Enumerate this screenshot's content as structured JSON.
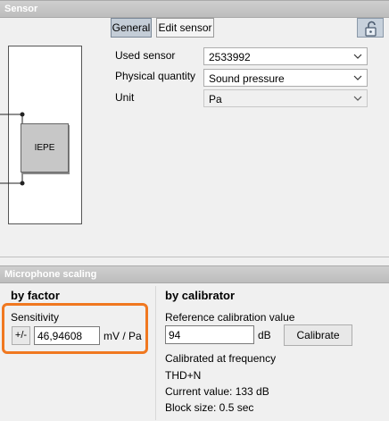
{
  "sensor_section": {
    "title": "Sensor",
    "tabs": [
      {
        "label": "General",
        "active": true
      },
      {
        "label": "Edit sensor",
        "active": false
      }
    ],
    "lock_icon": "unlocked-padlock-icon",
    "diagram": {
      "block_label": "IEPE"
    },
    "fields": {
      "used_sensor": {
        "label": "Used sensor",
        "value": "2533992"
      },
      "physical_quantity": {
        "label": "Physical quantity",
        "value": "Sound pressure"
      },
      "unit": {
        "label": "Unit",
        "value": "Pa"
      }
    }
  },
  "mic_section": {
    "title": "Microphone scaling",
    "by_factor": {
      "title": "by factor",
      "sensitivity_label": "Sensitivity",
      "sign_toggle_label": "+/-",
      "sensitivity_value": "46,94608",
      "sensitivity_unit": "mV / Pa"
    },
    "by_calibrator": {
      "title": "by calibrator",
      "ref_label": "Reference calibration value",
      "ref_value": "94",
      "ref_unit": "dB",
      "calibrate_label": "Calibrate",
      "cal_freq_label": "Calibrated at frequency",
      "thd_label": "THD+N",
      "current_value_label": "Current value: 133 dB",
      "block_size_label": "Block size: 0.5 sec"
    }
  },
  "colors": {
    "highlight": "#f07820",
    "active_tab": "#c4cdd7"
  }
}
